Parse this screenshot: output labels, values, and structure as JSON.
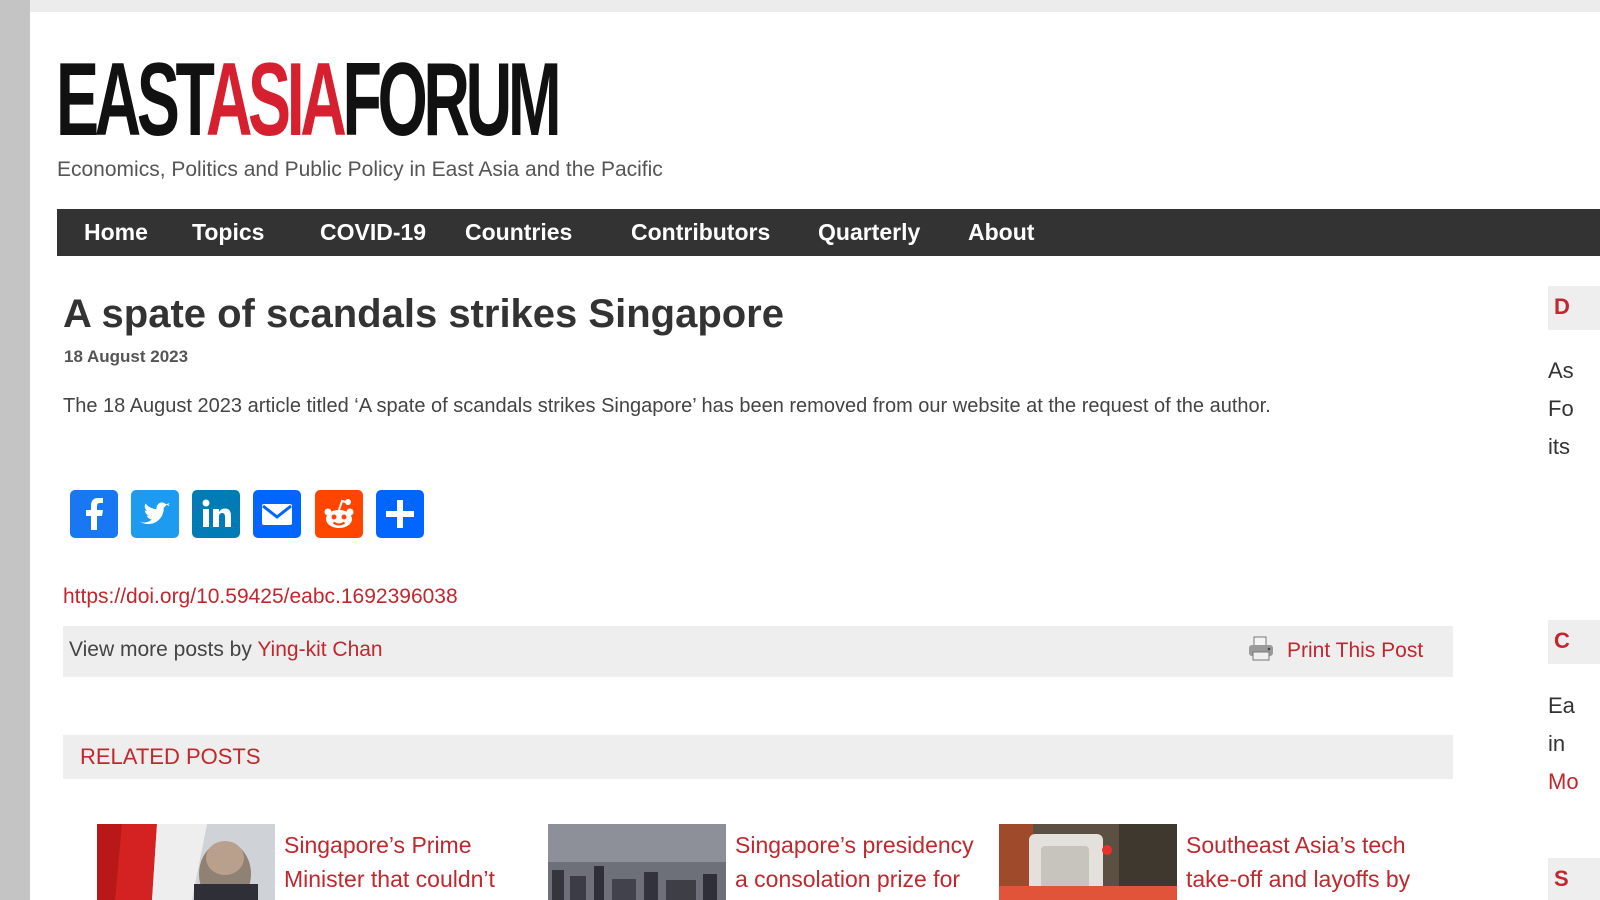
{
  "site": {
    "logo": {
      "part1": "EAST",
      "part2": "ASIA",
      "part3": "FORUM"
    },
    "tagline": "Economics, Politics and Public Policy in East Asia and the Pacific"
  },
  "nav": {
    "items": [
      {
        "label": "Home"
      },
      {
        "label": "Topics"
      },
      {
        "label": "COVID-19"
      },
      {
        "label": "Countries"
      },
      {
        "label": "Contributors"
      },
      {
        "label": "Quarterly"
      },
      {
        "label": "About"
      }
    ]
  },
  "article": {
    "title": "A spate of scandals strikes Singapore",
    "date": "18 August 2023",
    "body": "The 18 August 2023 article titled ‘A spate of scandals strikes Singapore’ has been removed from our website at the request of the author.",
    "doi": "https://doi.org/10.59425/eabc.1692396038",
    "author_prefix": "View more posts by ",
    "author_name": "Ying-kit Chan",
    "print_label": "Print This Post"
  },
  "share": {
    "buttons": [
      {
        "name": "facebook",
        "color": "#1877f2",
        "icon": "facebook-icon"
      },
      {
        "name": "twitter",
        "color": "#1d9bf0",
        "icon": "twitter-icon"
      },
      {
        "name": "linkedin",
        "color": "#007bb5",
        "icon": "linkedin-icon"
      },
      {
        "name": "email",
        "color": "#0166ff",
        "icon": "email-icon"
      },
      {
        "name": "reddit",
        "color": "#ff4500",
        "icon": "reddit-icon"
      },
      {
        "name": "more",
        "color": "#0166ff",
        "icon": "plus-icon"
      }
    ]
  },
  "related": {
    "heading": "RELATED POSTS",
    "posts": [
      {
        "line1": "Singapore’s Prime",
        "line2": "Minister that couldn’t"
      },
      {
        "line1": "Singapore’s presidency",
        "line2": "a consolation prize for"
      },
      {
        "line1": "Southeast Asia’s tech",
        "line2": "take-off and layoffs by"
      }
    ]
  },
  "sidebar": {
    "box1_letter": "D",
    "text1": [
      "As",
      "Fo",
      "its"
    ],
    "box2_letter": "C",
    "text2": [
      "Ea",
      "in"
    ],
    "link2": "Mo",
    "box3_letter": "S"
  },
  "colors": {
    "accent": "#c1272d",
    "logo_red": "#d6202f",
    "nav_bg": "#333333",
    "panel_bg": "#eeeeee"
  }
}
